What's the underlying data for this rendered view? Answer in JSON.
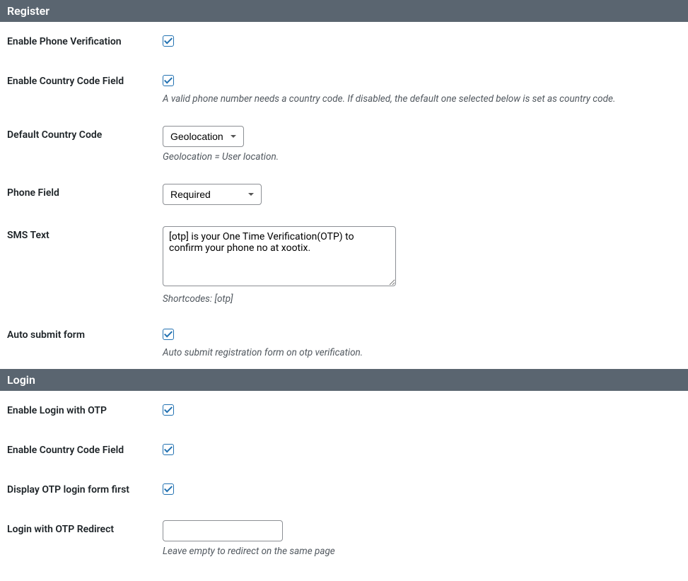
{
  "sections": {
    "register": {
      "title": "Register",
      "fields": {
        "enable_phone_verification": {
          "label": "Enable Phone Verification",
          "checked": true
        },
        "enable_country_code": {
          "label": "Enable Country Code Field",
          "checked": true,
          "description": "A valid phone number needs a country code. If disabled, the default one selected below is set as country code."
        },
        "default_country_code": {
          "label": "Default Country Code",
          "selected": "Geolocation",
          "description": "Geolocation = User location."
        },
        "phone_field": {
          "label": "Phone Field",
          "selected": "Required"
        },
        "sms_text": {
          "label": "SMS Text",
          "value": "[otp] is your One Time Verification(OTP) to confirm your phone no at xootix.",
          "description": "Shortcodes: [otp]"
        },
        "auto_submit": {
          "label": "Auto submit form",
          "checked": true,
          "description": "Auto submit registration form on otp verification."
        }
      }
    },
    "login": {
      "title": "Login",
      "fields": {
        "enable_login_otp": {
          "label": "Enable Login with OTP",
          "checked": true
        },
        "enable_country_code": {
          "label": "Enable Country Code Field",
          "checked": true
        },
        "display_otp_first": {
          "label": "Display OTP login form first",
          "checked": true
        },
        "login_otp_redirect": {
          "label": "Login with OTP Redirect",
          "value": "",
          "description": "Leave empty to redirect on the same page"
        }
      }
    }
  }
}
